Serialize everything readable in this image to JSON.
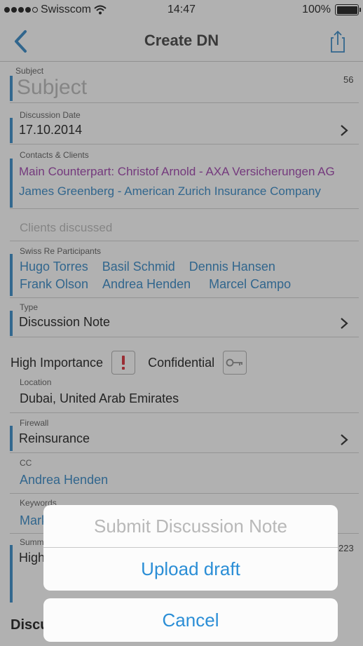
{
  "status": {
    "carrier": "Swisscom",
    "time": "14:47",
    "battery": "100%"
  },
  "nav": {
    "title": "Create DN"
  },
  "subject": {
    "label": "Subject",
    "placeholder": "Subject",
    "count": "56"
  },
  "discussion_date": {
    "label": "Discussion Date",
    "value": "17.10.2014"
  },
  "contacts": {
    "label": "Contacts & Clients",
    "main": "Main Counterpart: Christof Arnold - AXA Versicherungen AG",
    "second": "James Greenberg - American Zurich Insurance Company"
  },
  "clients_discussed": {
    "placeholder": "Clients discussed"
  },
  "participants": {
    "label": "Swiss Re Participants",
    "names": [
      "Hugo Torres",
      "Basil Schmid",
      "Dennis Hansen",
      "Frank Olson",
      "Andrea Henden",
      "Marcel Campo"
    ]
  },
  "type": {
    "label": "Type",
    "value": "Discussion Note"
  },
  "flags": {
    "high_importance": "High Importance",
    "confidential": "Confidential"
  },
  "location": {
    "label": "Location",
    "value": "Dubai, United Arab Emirates"
  },
  "firewall": {
    "label": "Firewall",
    "value": "Reinsurance"
  },
  "cc": {
    "label": "CC",
    "value": "Andrea Henden"
  },
  "keywords": {
    "label": "Keywords",
    "value": "Mark"
  },
  "summary": {
    "label": "Summ",
    "value": "High",
    "count": "223"
  },
  "discussion_header": "Discu",
  "action_sheet": {
    "title": "Submit Discussion Note",
    "upload": "Upload draft",
    "cancel": "Cancel"
  }
}
